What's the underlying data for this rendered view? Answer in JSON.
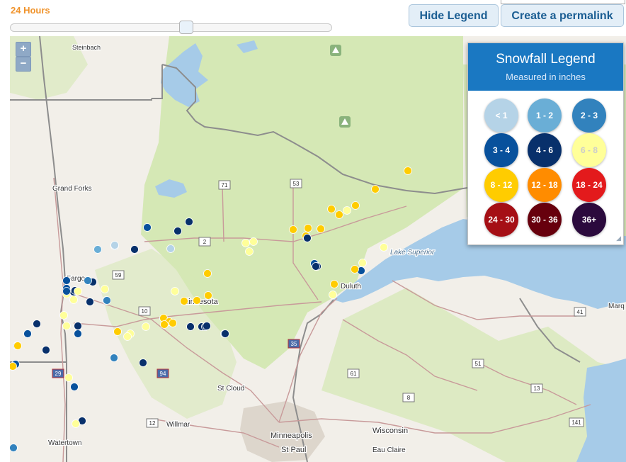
{
  "controls": {
    "period_label": "24 Hours",
    "hide_legend_label": "Hide Legend",
    "permalink_label": "Create a permalink",
    "zoom_in": "+",
    "zoom_out": "−",
    "slider_value": 0.55
  },
  "legend": {
    "title": "Snowfall Legend",
    "subtitle": "Measured in inches",
    "items": [
      {
        "label": "< 1",
        "color": "#b5d3e7",
        "text_color": "#ffffff"
      },
      {
        "label": "1 - 2",
        "color": "#6aaed6",
        "text_color": "#ffffff"
      },
      {
        "label": "2 - 3",
        "color": "#3282bd",
        "text_color": "#ffffff"
      },
      {
        "label": "3 - 4",
        "color": "#08519c",
        "text_color": "#ffffff"
      },
      {
        "label": "4 - 6",
        "color": "#08306b",
        "text_color": "#ffffff"
      },
      {
        "label": "6 - 8",
        "color": "#ffff99",
        "text_color": "#cccccc"
      },
      {
        "label": "8 - 12",
        "color": "#ffcc00",
        "text_color": "#ffffff"
      },
      {
        "label": "12 - 18",
        "color": "#ff8c00",
        "text_color": "#ffffff"
      },
      {
        "label": "18 - 24",
        "color": "#e31a1c",
        "text_color": "#ffffff"
      },
      {
        "label": "24 - 30",
        "color": "#a50f15",
        "text_color": "#ffffff"
      },
      {
        "label": "30 - 36",
        "color": "#67000d",
        "text_color": "#ffffff"
      },
      {
        "label": "36+",
        "color": "#2b0a3d",
        "text_color": "#ffffff"
      }
    ]
  },
  "map": {
    "colors": {
      "land": "#f2efe9",
      "forest": "#d5e8b5",
      "water": "#a6cbe8",
      "urban": "#ddd6cc",
      "border": "#8d8d8d",
      "road": "#c89a9a"
    },
    "places": [
      {
        "name": "Steinbach"
      },
      {
        "name": "Grand Forks"
      },
      {
        "name": "Fargo"
      },
      {
        "name": "Minnesota"
      },
      {
        "name": "Duluth"
      },
      {
        "name": "Lake Superior"
      },
      {
        "name": "St Cloud"
      },
      {
        "name": "Willmar"
      },
      {
        "name": "Minneapolis"
      },
      {
        "name": "St Paul"
      },
      {
        "name": "Wisconsin"
      },
      {
        "name": "Eau Claire"
      },
      {
        "name": "Watertown"
      },
      {
        "name": "Marq"
      }
    ],
    "routes": [
      "71",
      "53",
      "2",
      "59",
      "10",
      "35",
      "94",
      "29",
      "8",
      "51",
      "41",
      "141",
      "12",
      "13",
      "61"
    ],
    "markers": [
      {
        "category": "4 - 6"
      },
      {
        "category": "4 - 6"
      },
      {
        "category": "4 - 6"
      },
      {
        "category": "3 - 4"
      },
      {
        "category": "2 - 3"
      },
      {
        "category": "1 - 2"
      },
      {
        "category": "< 1"
      },
      {
        "category": "< 1"
      },
      {
        "category": "6 - 8"
      },
      {
        "category": "6 - 8"
      },
      {
        "category": "8 - 12"
      },
      {
        "category": "8 - 12"
      },
      {
        "category": "8 - 12"
      },
      {
        "category": "8 - 12"
      },
      {
        "category": "8 - 12"
      },
      {
        "category": "6 - 8"
      },
      {
        "category": "3 - 4"
      },
      {
        "category": "4 - 6"
      },
      {
        "category": "4 - 6"
      },
      {
        "category": "4 - 6"
      },
      {
        "category": "4 - 6"
      },
      {
        "category": "3 - 4"
      },
      {
        "category": "3 - 4"
      },
      {
        "category": "6 - 8"
      },
      {
        "category": "6 - 8"
      },
      {
        "category": "8 - 12"
      },
      {
        "category": "8 - 12"
      },
      {
        "category": "2 - 3"
      },
      {
        "category": "4 - 6"
      },
      {
        "category": "6 - 8"
      },
      {
        "category": "8 - 12"
      },
      {
        "category": "4 - 6"
      },
      {
        "category": "4 - 6"
      },
      {
        "category": "4 - 6"
      },
      {
        "category": "3 - 4"
      },
      {
        "category": "6 - 8"
      },
      {
        "category": "8 - 12"
      },
      {
        "category": "6 - 8"
      },
      {
        "category": "3 - 4"
      },
      {
        "category": "3 - 4"
      },
      {
        "category": "4 - 6"
      },
      {
        "category": "4 - 6"
      },
      {
        "category": "6 - 8"
      },
      {
        "category": "6 - 8"
      },
      {
        "category": "8 - 12"
      },
      {
        "category": "6 - 8"
      },
      {
        "category": "2 - 3"
      },
      {
        "category": "4 - 6"
      },
      {
        "category": "4 - 6"
      },
      {
        "category": "4 - 6"
      },
      {
        "category": "2 - 3"
      },
      {
        "category": "4 - 6"
      },
      {
        "category": "3 - 4"
      },
      {
        "category": "8 - 12"
      },
      {
        "category": "3 - 4"
      },
      {
        "category": "4 - 6"
      },
      {
        "category": "4 - 6"
      },
      {
        "category": "3 - 4"
      },
      {
        "category": "3 - 4"
      },
      {
        "category": "6 - 8"
      },
      {
        "category": "4 - 6"
      },
      {
        "category": "6 - 8"
      },
      {
        "category": "8 - 12"
      },
      {
        "category": "8 - 12"
      },
      {
        "category": "8 - 12"
      },
      {
        "category": "8 - 12"
      },
      {
        "category": "6 - 8"
      },
      {
        "category": "8 - 12"
      },
      {
        "category": "8 - 12"
      },
      {
        "category": "6 - 8"
      },
      {
        "category": "8 - 12"
      },
      {
        "category": "8 - 12"
      },
      {
        "category": "3 - 4"
      },
      {
        "category": "6 - 8"
      },
      {
        "category": "6 - 8"
      },
      {
        "category": "2 - 3"
      },
      {
        "category": "8 - 12"
      },
      {
        "category": "8 - 12"
      },
      {
        "category": "3 - 4"
      },
      {
        "category": "6 - 8"
      },
      {
        "category": "8 - 12"
      },
      {
        "category": "8 - 12"
      },
      {
        "category": "6 - 8"
      }
    ]
  }
}
